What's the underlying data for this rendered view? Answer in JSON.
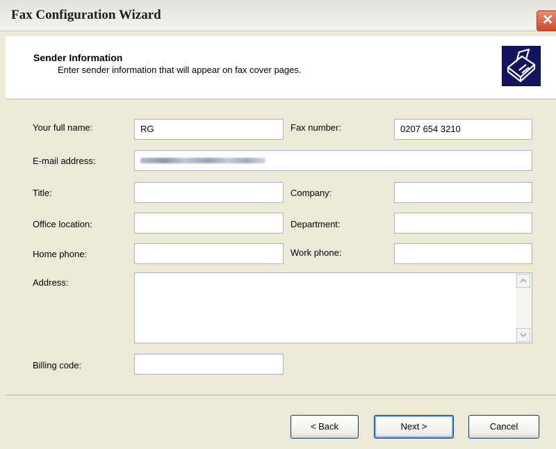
{
  "window": {
    "title": "Fax Configuration Wizard",
    "close_glyph": "✕"
  },
  "header": {
    "title": "Sender Information",
    "subtitle": "Enter sender information that will appear on fax cover pages.",
    "icon": "fax-machine-icon"
  },
  "form": {
    "full_name": {
      "label": "Your full name:",
      "value": "RG"
    },
    "fax_number": {
      "label": "Fax number:",
      "value": "0207 654 3210"
    },
    "email": {
      "label": "E-mail address:",
      "value": ""
    },
    "title": {
      "label": "Title:",
      "value": ""
    },
    "company": {
      "label": "Company:",
      "value": ""
    },
    "office_location": {
      "label": "Office location:",
      "value": ""
    },
    "department": {
      "label": "Department:",
      "value": ""
    },
    "home_phone": {
      "label": "Home phone:",
      "value": ""
    },
    "work_phone": {
      "label": "Work phone:",
      "value": ""
    },
    "address": {
      "label": "Address:",
      "value": ""
    },
    "billing_code": {
      "label": "Billing code:",
      "value": ""
    }
  },
  "buttons": {
    "back": "< Back",
    "next": "Next >",
    "cancel": "Cancel"
  }
}
